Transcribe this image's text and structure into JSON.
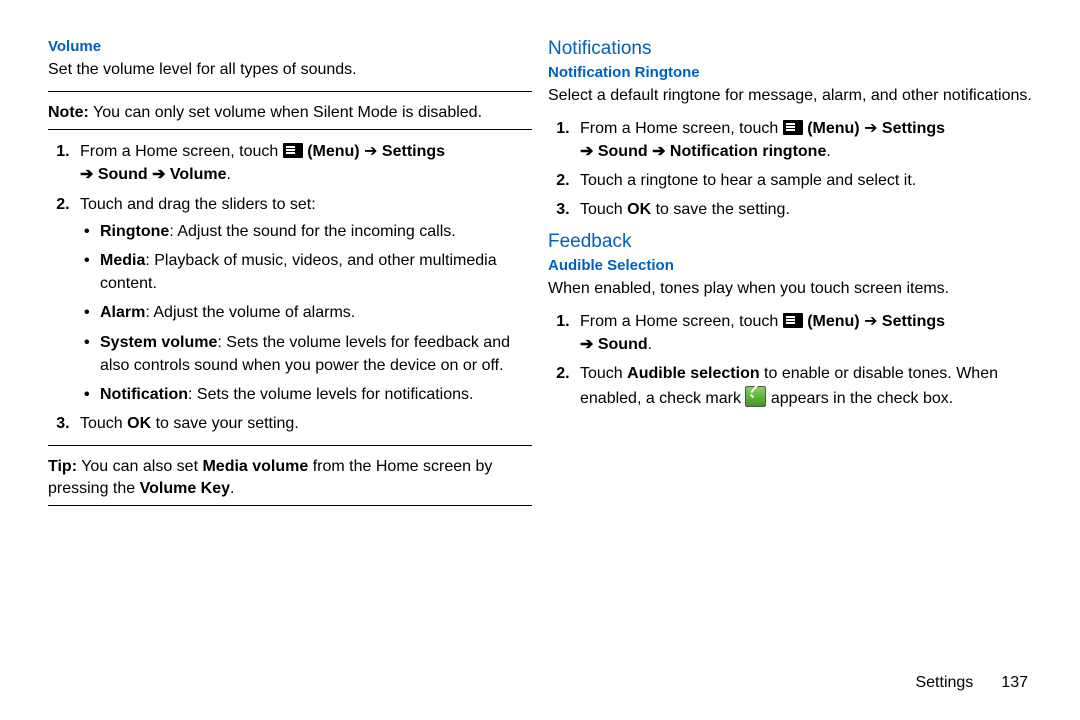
{
  "left": {
    "volume": {
      "heading": "Volume",
      "intro": "Set the volume level for all types of sounds.",
      "note_label": "Note:",
      "note_text": " You can only set volume when Silent Mode is disabled.",
      "s1_a": "From a Home screen, touch ",
      "s1_menu": " (Menu)",
      "s1_arrow1": " ➔ ",
      "s1_settings": "Settings",
      "s1_arrow2": "➔ ",
      "s1_sound": "Sound",
      "s1_arrow3": " ➔ ",
      "s1_volume": "Volume",
      "s1_dot": ".",
      "s2": "Touch and drag the sliders to set:",
      "b_ring_l": "Ringtone",
      "b_ring_t": ": Adjust the sound for the incoming calls.",
      "b_med_l": "Media",
      "b_med_t": ": Playback of music, videos, and other multimedia content.",
      "b_alarm_l": "Alarm",
      "b_alarm_t": ": Adjust the volume of alarms.",
      "b_sys_l": "System volume",
      "b_sys_t": ": Sets the volume levels for feedback and also controls sound when you power the device on or off.",
      "b_notif_l": "Notification",
      "b_notif_t": ": Sets the volume levels for notifications.",
      "s3_a": "Touch ",
      "s3_ok": "OK",
      "s3_b": " to save your setting.",
      "tip_label": "Tip:",
      "tip_a": " You can also set ",
      "tip_media": "Media volume",
      "tip_b": " from the Home screen by pressing the ",
      "tip_key": "Volume Key",
      "tip_dot": "."
    }
  },
  "right": {
    "notifications": {
      "section": "Notifications",
      "heading": "Notification Ringtone",
      "intro": "Select a default ringtone for message, alarm, and other notifications.",
      "s1_a": "From a Home screen, touch ",
      "s1_menu": " (Menu)",
      "s1_arrow1": " ➔ ",
      "s1_settings": "Settings",
      "s1_arrow2": "➔ ",
      "s1_sound": "Sound",
      "s1_arrow3": " ➔ ",
      "s1_nr": "Notification ringtone",
      "s1_dot": ".",
      "s2": "Touch a ringtone to hear a sample and select it.",
      "s3_a": "Touch ",
      "s3_ok": "OK",
      "s3_b": " to save the setting."
    },
    "feedback": {
      "section": "Feedback",
      "heading": "Audible Selection",
      "intro": "When enabled, tones play when you touch screen items.",
      "s1_a": "From a Home screen, touch ",
      "s1_menu": " (Menu)",
      "s1_arrow1": " ➔ ",
      "s1_settings": "Settings",
      "s1_arrow2": "➔ ",
      "s1_sound": "Sound",
      "s1_dot": ".",
      "s2_a": "Touch ",
      "s2_as": "Audible selection",
      "s2_b": " to enable or disable tones. When enabled, a check mark ",
      "s2_c": " appears in the check box."
    }
  },
  "footer": {
    "section": "Settings",
    "page": "137"
  }
}
